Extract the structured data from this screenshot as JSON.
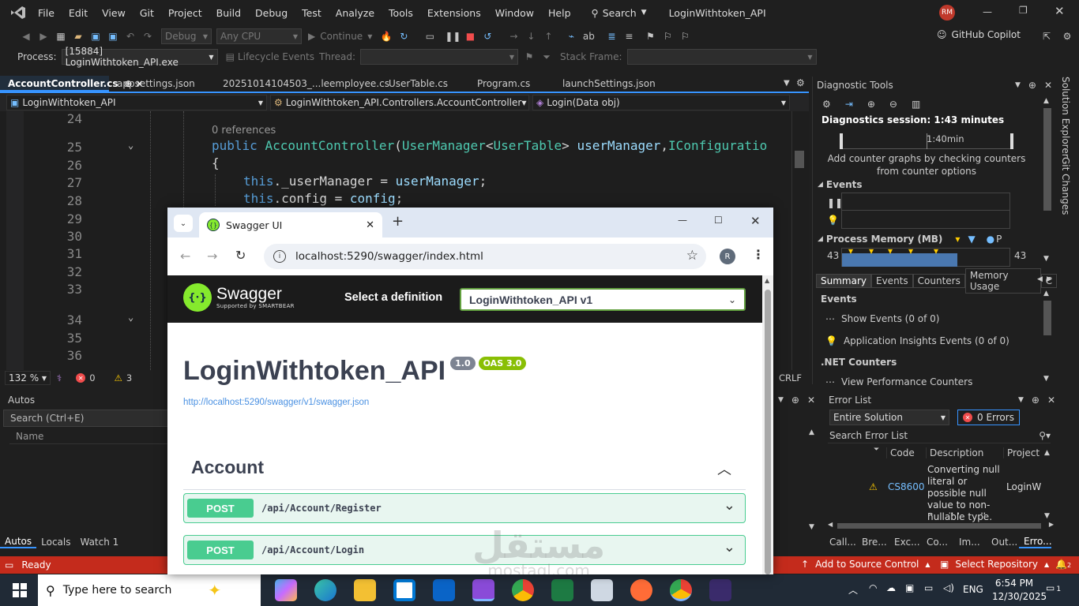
{
  "vs": {
    "menus": [
      "File",
      "Edit",
      "View",
      "Git",
      "Project",
      "Build",
      "Debug",
      "Test",
      "Analyze",
      "Tools",
      "Extensions",
      "Window",
      "Help"
    ],
    "search_label": "Search",
    "solution_title": "LoginWithtoken_API",
    "user_initials": "RM",
    "toolbar": {
      "config": "Debug",
      "platform": "Any CPU",
      "continue": "Continue",
      "copilot": "GitHub Copilot"
    },
    "debugbar": {
      "process_label": "Process:",
      "process_value": "[15884] LoginWithtoken_API.exe",
      "lifecycle": "Lifecycle Events",
      "thread_label": "Thread:",
      "stackframe_label": "Stack Frame:"
    },
    "tabs": [
      "AccountController.cs",
      "appsettings.json",
      "20251014104503_...leemployee.cs",
      "UserTable.cs",
      "Program.cs",
      "launchSettings.json"
    ],
    "tab_pin": "⊕",
    "tab_close": "×",
    "nav": {
      "project": "LoginWithtoken_API",
      "class": "LoginWithtoken_API.Controllers.AccountController",
      "member": "Login(Data obj)"
    },
    "editor": {
      "lines": [
        "24",
        "25",
        "26",
        "27",
        "28",
        "29",
        "30",
        "31",
        "32",
        "33",
        "34",
        "35",
        "36"
      ],
      "codelens": "0 references",
      "code_kw_public": "public",
      "code_name": "AccountController",
      "code_paren": "(",
      "code_type1": "UserManager",
      "code_lt": "<",
      "code_type2": "UserTable",
      "code_gt": ">",
      "code_param": "userManager",
      "code_comma": ",",
      "code_type3": "IConfiguratio",
      "code_brace": "{",
      "code_this1": "this",
      "code_field1": "._userManager",
      "code_eq1": " = ",
      "code_val1": "userManager",
      "code_semi": ";",
      "code_this2": "this",
      "code_field2": ".config",
      "code_val2": "config"
    },
    "editstatus": {
      "zoom": "132 %",
      "errors": "0",
      "warnings": "3",
      "eol": "CRLF"
    },
    "autos": {
      "title": "Autos",
      "search_placeholder": "Search (Ctrl+E)",
      "col_name": "Name",
      "tabs": [
        "Autos",
        "Locals",
        "Watch 1"
      ]
    },
    "diag": {
      "title": "Diagnostic Tools",
      "session": "Diagnostics session: 1:43 minutes",
      "timeline_label": "1:40min",
      "add_counter_text": "Add counter graphs by checking counters from counter options",
      "events_header": "Events",
      "memory_header": "Process Memory (MB)",
      "memory_legend_p": "P",
      "memory_min": "43",
      "memory_max": "43",
      "tabs": [
        "Summary",
        "Events",
        "Counters",
        "Memory Usage",
        "C"
      ],
      "events_section": "Events",
      "show_events": "Show Events (0 of 0)",
      "app_insights": "Application Insights Events (0 of 0)",
      "net_counters": ".NET Counters",
      "view_perf": "View Performance Counters"
    },
    "errors": {
      "title": "Error List",
      "scope": "Entire Solution",
      "errors_btn": "0 Errors",
      "search_placeholder": "Search Error List",
      "cols": [
        "Code",
        "Description",
        "Project"
      ],
      "row": {
        "code": "CS8600",
        "description": "Converting null literal or possible null value to non-nullable type.",
        "description_more": "Possible null",
        "project": "LoginWi"
      },
      "bottom_tabs": [
        "Call...",
        "Bre...",
        "Exc...",
        "Co...",
        "Im...",
        "Out...",
        "Erro..."
      ]
    },
    "side_tabs": [
      "Solution Explorer",
      "Git Changes"
    ],
    "status": {
      "ready": "Ready",
      "source_control": "Add to Source Control",
      "repo": "Select Repository",
      "notif_count": "2"
    }
  },
  "chrome": {
    "tab_title": "Swagger UI",
    "url": "localhost:5290/swagger/index.html",
    "profile": "R"
  },
  "swagger": {
    "logo_text": "Swagger",
    "logo_sub": "Supported by SMARTBEAR",
    "select_label": "Select a definition",
    "definition": "LoginWithtoken_API v1",
    "api_title": "LoginWithtoken_API",
    "version": "1.0",
    "oas": "OAS 3.0",
    "spec_link": "http://localhost:5290/swagger/v1/swagger.json",
    "section": "Account",
    "ops": [
      {
        "method": "POST",
        "path": "/api/Account/Register"
      },
      {
        "method": "POST",
        "path": "/api/Account/Login"
      }
    ]
  },
  "watermark": {
    "arabic": "مستقل",
    "latin": "mostaql.com"
  },
  "taskbar": {
    "search_placeholder": "Type here to search",
    "lang": "ENG",
    "time": "6:54 PM",
    "date": "12/30/2025",
    "notif": "1"
  },
  "colors": {
    "accent": "#3794ff",
    "status_red": "#c42b1c",
    "swagger_green": "#49cc90",
    "oas_green": "#89bf04",
    "version_gray": "#7d8492"
  }
}
